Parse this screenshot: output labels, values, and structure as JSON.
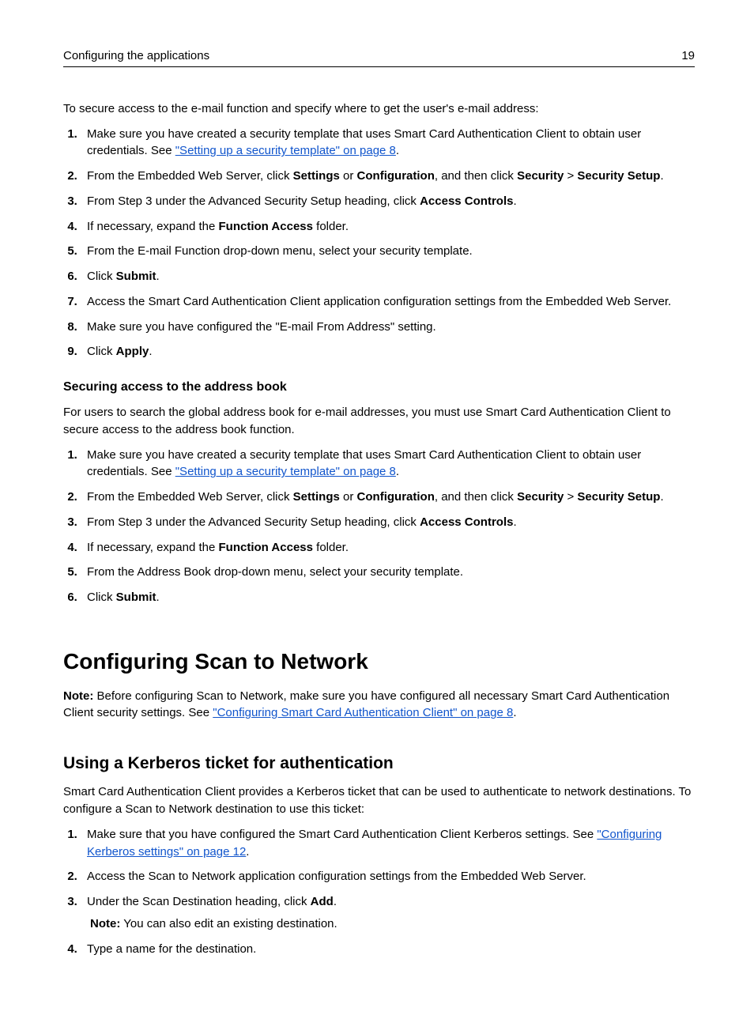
{
  "header": {
    "title": "Configuring the applications",
    "page": "19"
  },
  "intro1": "To secure access to the e-mail function and specify where to get the user's e-mail address:",
  "list1": {
    "i1a": "Make sure you have created a security template that uses Smart Card Authentication Client to obtain user credentials. See ",
    "i1b": "\"Setting up a security template\" on page 8",
    "i1c": ".",
    "i2a": "From the Embedded Web Server, click ",
    "i2b": "Settings",
    "i2c": " or ",
    "i2d": "Configuration",
    "i2e": ", and then click ",
    "i2f": "Security",
    "i2g": " > ",
    "i2h": "Security Setup",
    "i2i": ".",
    "i3a": "From Step 3 under the Advanced Security Setup heading, click ",
    "i3b": "Access Controls",
    "i3c": ".",
    "i4a": "If necessary, expand the ",
    "i4b": "Function Access",
    "i4c": " folder.",
    "i5": "From the E-mail Function drop-down menu, select your security template.",
    "i6a": "Click ",
    "i6b": "Submit",
    "i6c": ".",
    "i7": "Access the Smart Card Authentication Client application configuration settings from the Embedded Web Server.",
    "i8": "Make sure you have configured the \"E-mail From Address\" setting.",
    "i9a": "Click ",
    "i9b": "Apply",
    "i9c": "."
  },
  "secAB": {
    "title": "Securing access to the address book",
    "intro": "For users to search the global address book for e-mail addresses, you must use Smart Card Authentication Client to secure access to the address book function.",
    "i1a": "Make sure you have created a security template that uses Smart Card Authentication Client to obtain user credentials. See ",
    "i1b": "\"Setting up a security template\" on page 8",
    "i1c": ".",
    "i2a": "From the Embedded Web Server, click ",
    "i2b": "Settings",
    "i2c": " or ",
    "i2d": "Configuration",
    "i2e": ", and then click ",
    "i2f": "Security",
    "i2g": " > ",
    "i2h": "Security Setup",
    "i2i": ".",
    "i3a": "From Step 3 under the Advanced Security Setup heading, click ",
    "i3b": "Access Controls",
    "i3c": ".",
    "i4a": "If necessary, expand the ",
    "i4b": "Function Access",
    "i4c": " folder.",
    "i5": "From the Address Book drop-down menu, select your security template.",
    "i6a": "Click ",
    "i6b": "Submit",
    "i6c": "."
  },
  "scanNet": {
    "title": "Configuring Scan to Network",
    "noteLabel": "Note:",
    "noteTextA": " Before configuring Scan to Network, make sure you have configured all necessary Smart Card Authentication Client security settings. See ",
    "noteLink": "\"Configuring Smart Card Authentication Client\" on page 8",
    "noteTextB": "."
  },
  "kerberos": {
    "title": "Using a Kerberos ticket for authentication",
    "intro": "Smart Card Authentication Client provides a Kerberos ticket that can be used to authenticate to network destinations. To configure a Scan to Network destination to use this ticket:",
    "i1a": "Make sure that you have configured the Smart Card Authentication Client Kerberos settings. See ",
    "i1b": "\"Configuring Kerberos settings\" on page 12",
    "i1c": ".",
    "i2": "Access the Scan to Network application configuration settings from the Embedded Web Server.",
    "i3a": "Under the Scan Destination heading, click ",
    "i3b": "Add",
    "i3c": ".",
    "i3noteLabel": "Note:",
    "i3noteText": " You can also edit an existing destination.",
    "i4": "Type a name for the destination."
  }
}
